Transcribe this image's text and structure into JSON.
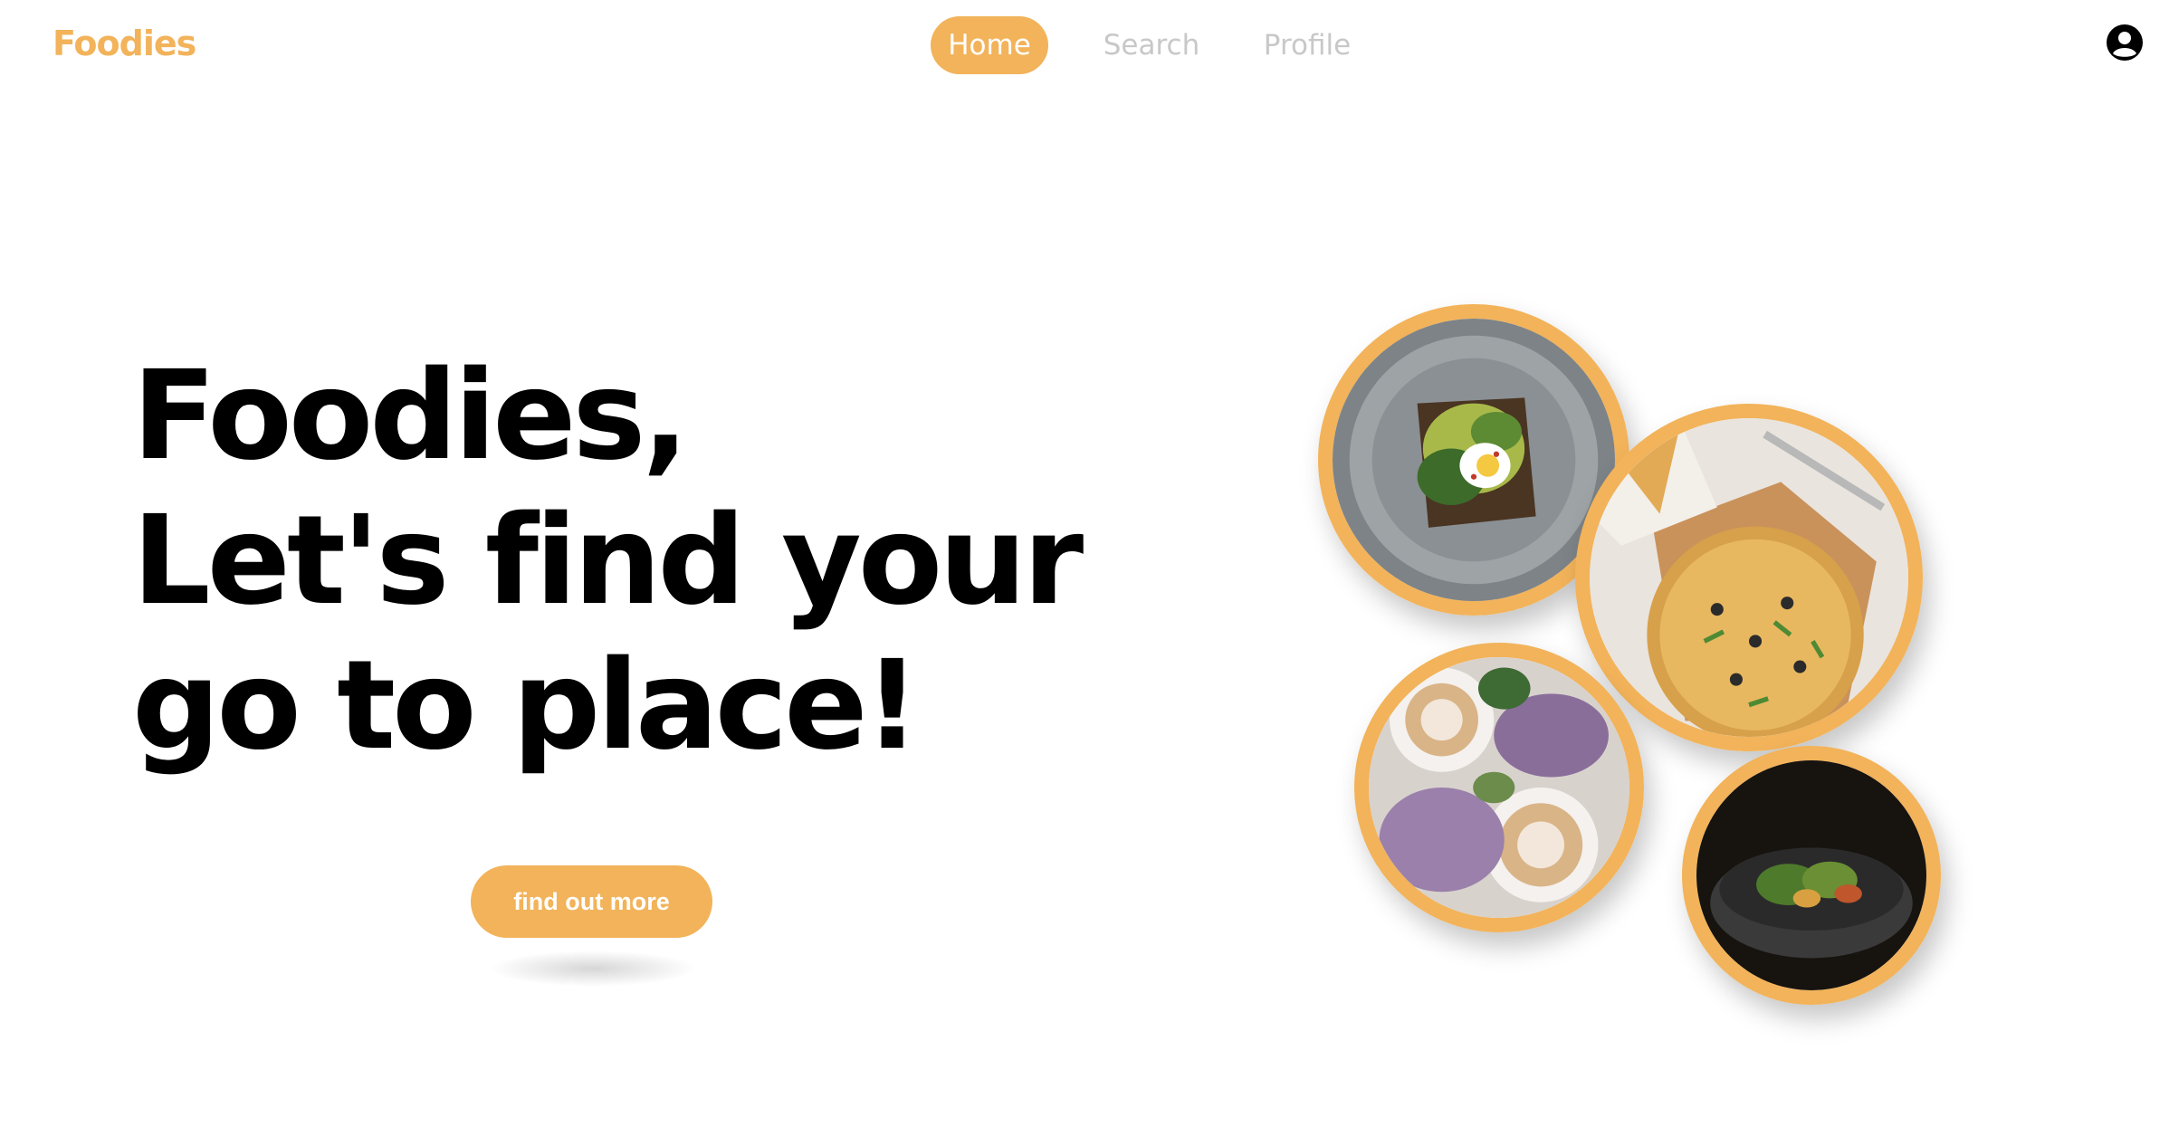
{
  "header": {
    "logo": "Foodies",
    "nav": {
      "home": "Home",
      "search": "Search",
      "profile": "Profile"
    },
    "account_icon": "account-circle-icon"
  },
  "hero": {
    "line1": "Foodies,",
    "line2": "Let's find your",
    "line3": "go to place!",
    "cta_label": "find out more"
  },
  "colors": {
    "accent": "#f2b35a",
    "nav_inactive": "#c8c8c8",
    "text": "#000000"
  }
}
